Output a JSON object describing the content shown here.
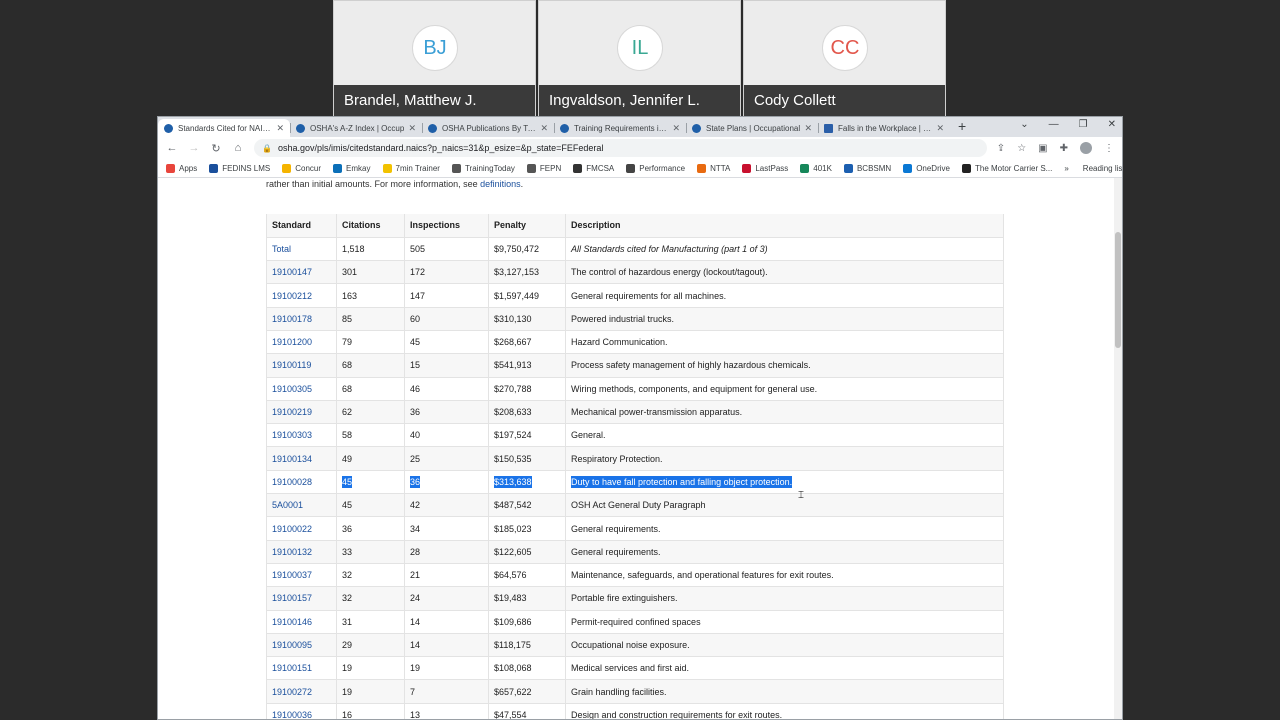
{
  "participants": [
    {
      "initials": "BJ",
      "name": "Brandel, Matthew J.",
      "color": "#3b9fd6"
    },
    {
      "initials": "IL",
      "name": "Ingvaldson, Jennifer L.",
      "color": "#3aa893"
    },
    {
      "initials": "CC",
      "name": "Cody Collett",
      "color": "#e2574c"
    }
  ],
  "browser": {
    "tabs": [
      {
        "title": "Standards Cited for NAICS",
        "active": true
      },
      {
        "title": "OSHA's A-Z Index | Occup"
      },
      {
        "title": "OSHA Publications By Type"
      },
      {
        "title": "Training Requirements in O"
      },
      {
        "title": "State Plans | Occupational"
      },
      {
        "title": "Falls in the Workplace | NIO"
      }
    ],
    "new_tab": "+",
    "url": "osha.gov/pls/imis/citedstandard.naics?p_naics=31&p_esize=&p_state=FEFederal",
    "bookmarks": [
      {
        "label": "Apps",
        "color": "#e8453c"
      },
      {
        "label": "FEDINS LMS",
        "color": "#1a4f9c"
      },
      {
        "label": "Concur",
        "color": "#f5b400"
      },
      {
        "label": "Emkay",
        "color": "#0b6fb8"
      },
      {
        "label": "7min Trainer",
        "color": "#f2c200"
      },
      {
        "label": "TrainingToday",
        "color": "#555555"
      },
      {
        "label": "FEPN",
        "color": "#555555"
      },
      {
        "label": "FMCSA",
        "color": "#333333"
      },
      {
        "label": "Performance",
        "color": "#444444"
      },
      {
        "label": "NTTA",
        "color": "#e86a10"
      },
      {
        "label": "LastPass",
        "color": "#c8102e"
      },
      {
        "label": "401K",
        "color": "#16875a"
      },
      {
        "label": "BCBSMN",
        "color": "#1c5fb0"
      },
      {
        "label": "OneDrive",
        "color": "#0a78d4"
      },
      {
        "label": "The Motor Carrier S...",
        "color": "#222222"
      }
    ],
    "bookmarks_more": "»",
    "reading_list": "Reading list"
  },
  "page": {
    "intro_text": "rather than initial amounts. For more information, see ",
    "intro_link": "definitions",
    "intro_end": ".",
    "table": {
      "headers": [
        "Standard",
        "Citations",
        "Inspections",
        "Penalty",
        "Description"
      ],
      "rows": [
        {
          "standard": "Total",
          "citations": "1,518",
          "inspections": "505",
          "penalty": "$9,750,472",
          "description": "All Standards cited for Manufacturing (part 1 of 3)",
          "italic": true
        },
        {
          "standard": "19100147",
          "citations": "301",
          "inspections": "172",
          "penalty": "$3,127,153",
          "description": "The control of hazardous energy (lockout/tagout)."
        },
        {
          "standard": "19100212",
          "citations": "163",
          "inspections": "147",
          "penalty": "$1,597,449",
          "description": "General requirements for all machines."
        },
        {
          "standard": "19100178",
          "citations": "85",
          "inspections": "60",
          "penalty": "$310,130",
          "description": "Powered industrial trucks."
        },
        {
          "standard": "19101200",
          "citations": "79",
          "inspections": "45",
          "penalty": "$268,667",
          "description": "Hazard Communication."
        },
        {
          "standard": "19100119",
          "citations": "68",
          "inspections": "15",
          "penalty": "$541,913",
          "description": "Process safety management of highly hazardous chemicals."
        },
        {
          "standard": "19100305",
          "citations": "68",
          "inspections": "46",
          "penalty": "$270,788",
          "description": "Wiring methods, components, and equipment for general use."
        },
        {
          "standard": "19100219",
          "citations": "62",
          "inspections": "36",
          "penalty": "$208,633",
          "description": "Mechanical power-transmission apparatus."
        },
        {
          "standard": "19100303",
          "citations": "58",
          "inspections": "40",
          "penalty": "$197,524",
          "description": "General."
        },
        {
          "standard": "19100134",
          "citations": "49",
          "inspections": "25",
          "penalty": "$150,535",
          "description": "Respiratory Protection."
        },
        {
          "standard": "19100028",
          "citations": "45",
          "inspections": "36",
          "penalty": "$313,638",
          "description": "Duty to have fall protection and falling object protection.",
          "selected": true
        },
        {
          "standard": "5A0001",
          "citations": "45",
          "inspections": "42",
          "penalty": "$487,542",
          "description": "OSH Act General Duty Paragraph"
        },
        {
          "standard": "19100022",
          "citations": "36",
          "inspections": "34",
          "penalty": "$185,023",
          "description": "General requirements."
        },
        {
          "standard": "19100132",
          "citations": "33",
          "inspections": "28",
          "penalty": "$122,605",
          "description": "General requirements."
        },
        {
          "standard": "19100037",
          "citations": "32",
          "inspections": "21",
          "penalty": "$64,576",
          "description": "Maintenance, safeguards, and operational features for exit routes."
        },
        {
          "standard": "19100157",
          "citations": "32",
          "inspections": "24",
          "penalty": "$19,483",
          "description": "Portable fire extinguishers."
        },
        {
          "standard": "19100146",
          "citations": "31",
          "inspections": "14",
          "penalty": "$109,686",
          "description": "Permit-required confined spaces"
        },
        {
          "standard": "19100095",
          "citations": "29",
          "inspections": "14",
          "penalty": "$118,175",
          "description": "Occupational noise exposure."
        },
        {
          "standard": "19100151",
          "citations": "19",
          "inspections": "19",
          "penalty": "$108,068",
          "description": "Medical services and first aid."
        },
        {
          "standard": "19100272",
          "citations": "19",
          "inspections": "7",
          "penalty": "$657,622",
          "description": "Grain handling facilities."
        },
        {
          "standard": "19100036",
          "citations": "16",
          "inspections": "13",
          "penalty": "$47,554",
          "description": "Design and construction requirements for exit routes."
        }
      ]
    }
  }
}
